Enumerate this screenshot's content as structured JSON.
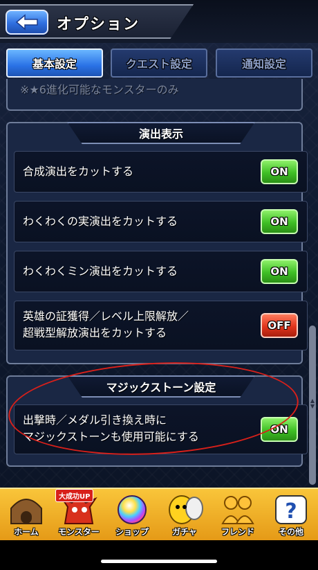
{
  "header": {
    "title": "オプション"
  },
  "tabs": [
    {
      "label": "基本設定",
      "active": true
    },
    {
      "label": "クエスト設定",
      "active": false
    },
    {
      "label": "通知設定",
      "active": false
    }
  ],
  "partial_row": {
    "text": "※★6進化可能なモンスターのみ"
  },
  "sections": {
    "effects": {
      "title": "演出表示",
      "rows": [
        {
          "label": "合成演出をカットする",
          "state": "ON"
        },
        {
          "label": "わくわくの実演出をカットする",
          "state": "ON"
        },
        {
          "label": "わくわくミン演出をカットする",
          "state": "ON"
        },
        {
          "label_line1": "英雄の証獲得／レベル上限解放／",
          "label_line2": "超戦型解放演出をカットする",
          "state": "OFF"
        }
      ]
    },
    "magic_stone": {
      "title": "マジックストーン設定",
      "rows": [
        {
          "label_line1": "出撃時／メダル引き換え時に",
          "label_line2": "マジックストーンも使用可能にする",
          "state": "ON"
        }
      ]
    }
  },
  "bottom_nav": [
    {
      "label": "ホーム",
      "icon": "home-icon"
    },
    {
      "label": "モンスター",
      "icon": "monster-icon",
      "badge": "大成功UP"
    },
    {
      "label": "ショップ",
      "icon": "orb-icon"
    },
    {
      "label": "ガチャ",
      "icon": "gacha-icon"
    },
    {
      "label": "フレンド",
      "icon": "friend-icon"
    },
    {
      "label": "その他",
      "icon": "question-icon"
    }
  ],
  "colors": {
    "on": "#3fbf25",
    "off": "#e0341c",
    "tab_active": "#2a72e6",
    "annotation": "#d8201a"
  }
}
